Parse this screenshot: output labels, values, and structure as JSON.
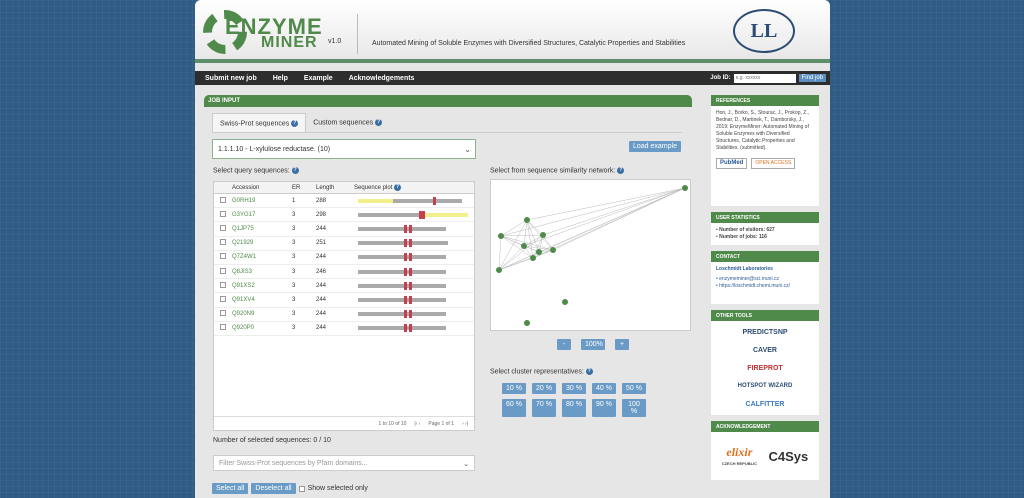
{
  "header": {
    "logo_word1": "ENZYME",
    "logo_word2": "MINER",
    "version": "v1.0",
    "tagline": "Automated Mining of Soluble Enzymes with Diversified Structures, Catalytic Properties and Stabilities",
    "lab_logo_letters": "LL"
  },
  "nav": {
    "items": [
      "Submit new job",
      "Help",
      "Example",
      "Acknowledgements"
    ],
    "jobid_label": "Job ID:",
    "jobid_placeholder": "e.g. xxxxxx",
    "find_label": "Find job"
  },
  "main": {
    "title": "JOB INPUT",
    "tabs": [
      "Swiss-Prot sequences",
      "Custom sequences"
    ],
    "query_value": "1.1.1.10 - L-xylulose reductase. (10)",
    "load_example": "Load example",
    "select_query_label": "Select query sequences:",
    "columns": [
      "Accession",
      "ER",
      "Length",
      "Sequence plot"
    ],
    "rows": [
      {
        "acc": "G0RH19",
        "er": "1",
        "len": "288"
      },
      {
        "acc": "G3YG17",
        "er": "3",
        "len": "298"
      },
      {
        "acc": "Q1JP75",
        "er": "3",
        "len": "244"
      },
      {
        "acc": "Q21929",
        "er": "3",
        "len": "251"
      },
      {
        "acc": "Q7Z4W1",
        "er": "3",
        "len": "244"
      },
      {
        "acc": "Q8JIS3",
        "er": "3",
        "len": "246"
      },
      {
        "acc": "Q91XS2",
        "er": "3",
        "len": "244"
      },
      {
        "acc": "Q91XV4",
        "er": "3",
        "len": "244"
      },
      {
        "acc": "Q920N9",
        "er": "3",
        "len": "244"
      },
      {
        "acc": "Q920P0",
        "er": "3",
        "len": "244"
      }
    ],
    "pager_text": "1 to 10 of 10",
    "page_text": "Page 1 of 1",
    "network_label": "Select from sequence similarity network:",
    "zoom": {
      "minus": "-",
      "level": "100%",
      "plus": "+"
    },
    "cluster_label": "Select cluster representatives:",
    "cluster_pcts": [
      "10 %",
      "20 %",
      "30 %",
      "40 %",
      "50 %",
      "60 %",
      "70 %",
      "80 %",
      "90 %",
      "100 %"
    ],
    "selected_count": "Number of selected sequences: 0 / 10",
    "filter_placeholder": "Filter Swiss-Prot sequences by Pfam domains...",
    "select_all": "Select all",
    "deselect_all": "Deselect all",
    "show_selected": "Show selected only"
  },
  "side": {
    "references_title": "REFERENCES",
    "references_text": "Hon, J., Borko, S., Stourac, J., Prokop, Z., Bednar, D., Martinek, T., Damborsky, J., 2019: EnzymeMiner: Automated Mining of Soluble Enzymes with Diversified Structures, Catalytic Properties and Stabilities. (submitted).",
    "pubmed": "PubMed",
    "open_access": "OPEN ACCESS",
    "stats_title": "USER STATISTICS",
    "stats": [
      "Number of visitors: 627",
      "Number of jobs: 116"
    ],
    "contact_title": "CONTACT",
    "contact_name": "Loschmidt Laboratories",
    "contact_links": [
      "enzymeminer@sci.muni.cz",
      "https://loschmidt.chemi.muni.cz/"
    ],
    "tools_title": "OTHER TOOLS",
    "tools": [
      "PREDICTSNP",
      "CAVER",
      "FIREPROT",
      "HOTSPOT WIZARD",
      "CALFITTER"
    ],
    "ack_title": "ACKNOWLEDGEMENT",
    "ack": [
      "elixir",
      "CZECH REPUBLIC",
      "C4Sys"
    ]
  }
}
